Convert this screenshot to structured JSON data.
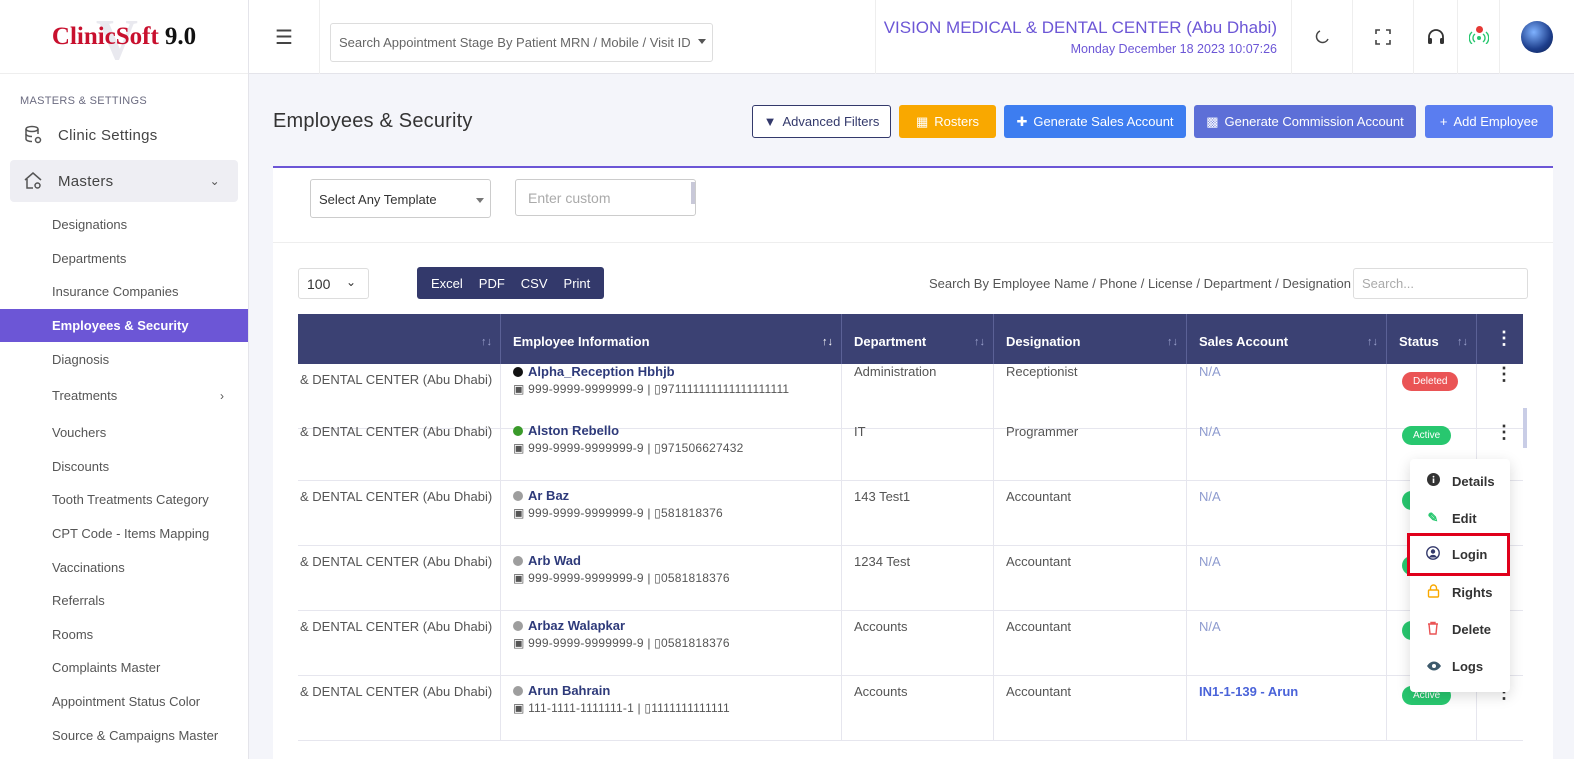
{
  "app": {
    "logo_part1": "ClinicSoft",
    "logo_part2": "9.0",
    "logo_watermark": "V"
  },
  "sidebar": {
    "section_title": "MASTERS & SETTINGS",
    "clinic_settings": "Clinic Settings",
    "masters": "Masters",
    "items": [
      {
        "label": "Designations"
      },
      {
        "label": "Departments"
      },
      {
        "label": "Insurance Companies"
      },
      {
        "label": "Employees & Security"
      },
      {
        "label": "Diagnosis"
      },
      {
        "label": "Treatments"
      },
      {
        "label": "Vouchers"
      },
      {
        "label": "Discounts"
      },
      {
        "label": "Tooth Treatments Category"
      },
      {
        "label": "CPT Code - Items Mapping"
      },
      {
        "label": "Vaccinations"
      },
      {
        "label": "Referrals"
      },
      {
        "label": "Rooms"
      },
      {
        "label": "Complaints Master"
      },
      {
        "label": "Appointment Status Color"
      },
      {
        "label": "Source & Campaigns Master"
      }
    ],
    "active_item": "Employees & Security",
    "accent_color": "#6c56d6"
  },
  "header": {
    "search_placeholder": "Search Appointment Stage By Patient MRN / Mobile / Visit ID",
    "clinic_name": "VISION MEDICAL & DENTAL CENTER (Abu Dhabi)",
    "datetime": "Monday December 18 2023 10:07:26",
    "icons": [
      "menu-icon",
      "moon-icon",
      "fullscreen-icon",
      "headset-icon",
      "broadcast-icon",
      "avatar"
    ]
  },
  "page": {
    "title": "Employees & Security",
    "buttons": {
      "advanced_filters": "Advanced Filters",
      "rosters": "Rosters",
      "generate_sales": "Generate Sales Account",
      "generate_commission": "Generate Commission Account",
      "add_employee": "Add Employee"
    },
    "template_select": "Select Any Template",
    "custom_placeholder": "Enter custom",
    "page_size": "100",
    "export": [
      "Excel",
      "PDF",
      "CSV",
      "Print"
    ],
    "search_label": "Search By Employee Name / Phone / License / Department / Designation",
    "search_placeholder": "Search..."
  },
  "table": {
    "headers": [
      "",
      "Employee Information",
      "Department",
      "Designation",
      "Sales Account",
      "Status"
    ],
    "rows": [
      {
        "clinic": "& DENTAL CENTER (Abu Dhabi)",
        "name": "Alpha_Reception Hbhjb",
        "dot": "#111111",
        "id": "999-9999-9999999-9",
        "phone": "971111111111111111111",
        "department": "Administration",
        "designation": "Receptionist",
        "sales": "N/A",
        "status": "Deleted"
      },
      {
        "clinic": "& DENTAL CENTER (Abu Dhabi)",
        "name": "Alston Rebello",
        "dot": "#3a9a2a",
        "id": "999-9999-9999999-9",
        "phone": "971506627432",
        "department": "IT",
        "designation": "Programmer",
        "sales": "N/A",
        "status": "Active"
      },
      {
        "clinic": "& DENTAL CENTER (Abu Dhabi)",
        "name": "Ar Baz",
        "dot": "#9e9e9e",
        "id": "999-9999-9999999-9",
        "phone": "581818376",
        "department": "143 Test1",
        "designation": "Accountant",
        "sales": "N/A",
        "status": ""
      },
      {
        "clinic": "& DENTAL CENTER (Abu Dhabi)",
        "name": "Arb Wad",
        "dot": "#9e9e9e",
        "id": "999-9999-9999999-9",
        "phone": "0581818376",
        "department": "1234 Test",
        "designation": "Accountant",
        "sales": "N/A",
        "status": ""
      },
      {
        "clinic": "& DENTAL CENTER (Abu Dhabi)",
        "name": "Arbaz Walapkar",
        "dot": "#9e9e9e",
        "id": "999-9999-9999999-9",
        "phone": "0581818376",
        "department": "Accounts",
        "designation": "Accountant",
        "sales": "N/A",
        "status": ""
      },
      {
        "clinic": "& DENTAL CENTER (Abu Dhabi)",
        "name": "Arun Bahrain",
        "dot": "#9e9e9e",
        "id": "111-1111-1111111-1",
        "phone": "1111111111111",
        "department": "Accounts",
        "designation": "Accountant",
        "sales": "IN1-1-139 - Arun",
        "status": "Active"
      }
    ]
  },
  "dropdown": {
    "items": [
      {
        "label": "Details",
        "icon": "info-icon"
      },
      {
        "label": "Edit",
        "icon": "pencil-icon"
      },
      {
        "label": "Login",
        "icon": "user-circle-icon"
      },
      {
        "label": "Rights",
        "icon": "lock-icon"
      },
      {
        "label": "Delete",
        "icon": "trash-icon"
      },
      {
        "label": "Logs",
        "icon": "eye-icon"
      }
    ],
    "highlighted": "Login"
  }
}
